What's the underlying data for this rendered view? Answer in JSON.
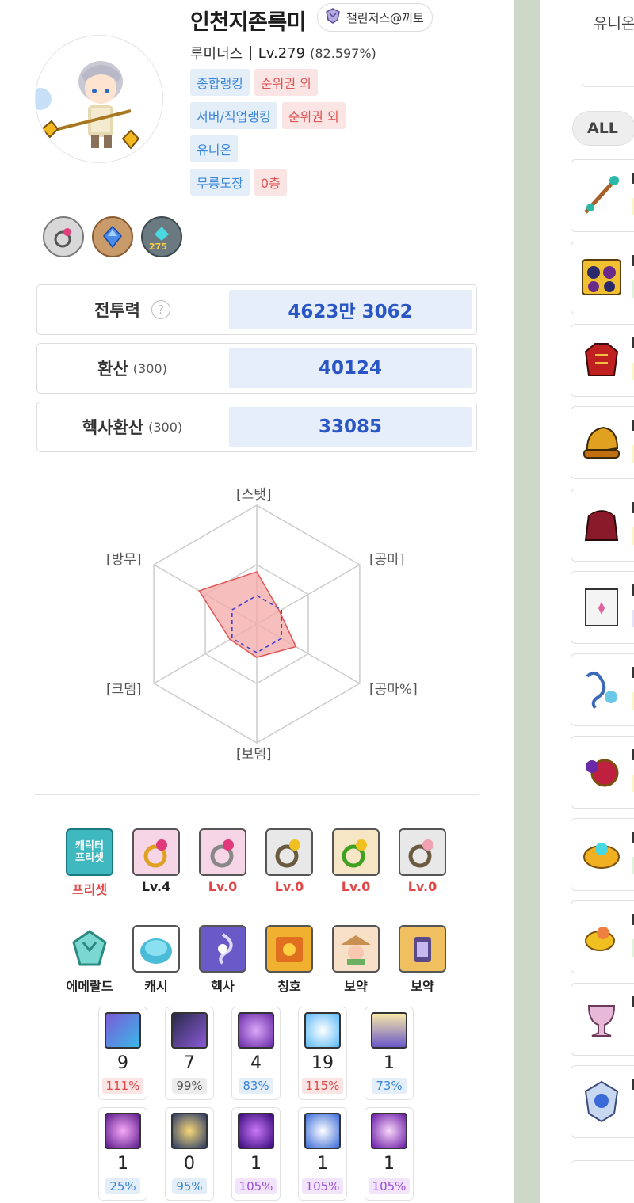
{
  "profile": {
    "name": "인천지존륵미",
    "guild": "챌린저스@끼토",
    "job": "루미너스",
    "level": "Lv.279",
    "exp_pct": "(82.597%)"
  },
  "ranks": [
    {
      "label": "종합랭킹",
      "value": "순위권 외"
    },
    {
      "label": "서버/직업랭킹",
      "value": "순위권 외"
    },
    {
      "label": "유니온",
      "value": ""
    },
    {
      "label": "무릉도장",
      "value": "0층"
    }
  ],
  "badges": [
    {
      "icon": "ring-badge-icon"
    },
    {
      "icon": "blue-gem-badge-icon"
    },
    {
      "icon": "level-badge-icon",
      "text": "275"
    }
  ],
  "stats": {
    "combat_power": {
      "label": "전투력",
      "help": "?",
      "value": "4623만 3062"
    },
    "hwansan": {
      "label": "환산",
      "sub": "(300)",
      "value": "40124"
    },
    "hexa_hwansan": {
      "label": "헥사환산",
      "sub": "(300)",
      "value": "33085"
    }
  },
  "radar": {
    "labels": [
      "[스탯]",
      "[공마]",
      "[공마%]",
      "[보뎀]",
      "[크뎀]",
      "[방무]"
    ],
    "values": [
      0.44,
      0.22,
      0.38,
      0.28,
      0.26,
      0.56
    ],
    "reference": [
      0.24,
      0.24,
      0.24,
      0.24,
      0.24,
      0.24
    ],
    "colors": {
      "fill": "#f4a8a8",
      "stroke": "#e25555",
      "reference": "#3a3ad0"
    }
  },
  "presets": [
    {
      "icon": "character-preset-icon",
      "icon_text": "캐릭터\n프리셋",
      "caption": "프리셋",
      "caption_color": "red"
    },
    {
      "icon": "gold-ring-icon",
      "caption": "Lv.4",
      "caption_color": "black"
    },
    {
      "icon": "silver-ring-icon",
      "caption": "Lv.0",
      "caption_color": "red"
    },
    {
      "icon": "bronze-ring-icon",
      "caption": "Lv.0",
      "caption_color": "red"
    },
    {
      "icon": "green-ring-icon",
      "caption": "Lv.0",
      "caption_color": "red"
    },
    {
      "icon": "rose-ring-icon",
      "caption": "Lv.0",
      "caption_color": "red"
    }
  ],
  "tabs": [
    {
      "icon": "emerald-icon",
      "caption": "에메랄드"
    },
    {
      "icon": "cash-icon",
      "caption": "캐시"
    },
    {
      "icon": "hexa-icon",
      "caption": "헥사"
    },
    {
      "icon": "title-icon",
      "caption": "칭호"
    },
    {
      "icon": "treasure-icon",
      "caption": "보약"
    },
    {
      "icon": "lantern-icon",
      "caption": "보약"
    }
  ],
  "skills_row1": [
    {
      "icon": "skill-icon",
      "level": "9",
      "pct": "111%",
      "tone": "red"
    },
    {
      "icon": "skill-icon",
      "level": "7",
      "pct": "99%",
      "tone": "gray"
    },
    {
      "icon": "skill-icon",
      "level": "4",
      "pct": "83%",
      "tone": "blue"
    },
    {
      "icon": "skill-icon",
      "level": "19",
      "pct": "115%",
      "tone": "red"
    },
    {
      "icon": "skill-icon",
      "level": "1",
      "pct": "73%",
      "tone": "blue"
    }
  ],
  "skills_row2": [
    {
      "icon": "skill-icon",
      "level": "1",
      "pct": "25%",
      "tone": "blue"
    },
    {
      "icon": "skill-icon",
      "level": "0",
      "pct": "95%",
      "tone": "blue"
    },
    {
      "icon": "skill-icon",
      "level": "1",
      "pct": "105%",
      "tone": "purple"
    },
    {
      "icon": "skill-icon",
      "level": "1",
      "pct": "105%",
      "tone": "purple"
    },
    {
      "icon": "skill-icon",
      "level": "1",
      "pct": "105%",
      "tone": "purple"
    }
  ],
  "right_panel": {
    "top_text": "유니온",
    "filter_label": "ALL"
  }
}
